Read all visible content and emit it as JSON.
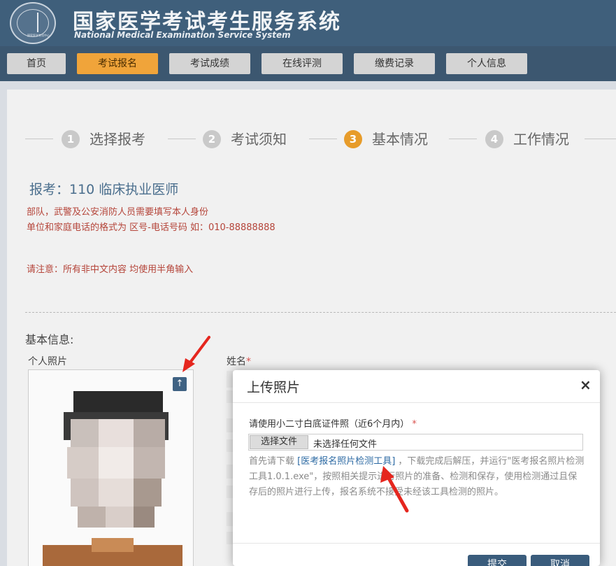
{
  "header": {
    "title": "国家医学考试考生服务系统",
    "subtitle": "National Medical Examination Service System",
    "logo_text": "国家医学考试中心"
  },
  "nav": {
    "items": [
      {
        "label": "首页"
      },
      {
        "label": "考试报名"
      },
      {
        "label": "考试成绩"
      },
      {
        "label": "在线评测"
      },
      {
        "label": "缴费记录"
      },
      {
        "label": "个人信息"
      }
    ],
    "active_index": 1
  },
  "steps": [
    {
      "num": "1",
      "label": "选择报考"
    },
    {
      "num": "2",
      "label": "考试须知"
    },
    {
      "num": "3",
      "label": "基本情况"
    },
    {
      "num": "4",
      "label": "工作情况"
    }
  ],
  "exam": {
    "title": "报考：110 临床执业医师",
    "notes": [
      "部队，武警及公安消防人员需要填写本人身份",
      "单位和家庭电话的格式为 区号-电话号码 如：010-88888888"
    ],
    "attention": "请注意：所有非中文内容 均使用半角输入"
  },
  "form": {
    "section_title": "基本信息:",
    "photo_label": "个人照片",
    "name_label": "姓名",
    "required_mark": "*"
  },
  "modal": {
    "title": "上传照片",
    "close_glyph": "×",
    "photo_label": "请使用小二寸白底证件照（近6个月内）",
    "required_mark": "*",
    "file_button": "选择文件",
    "file_status": "未选择任何文件",
    "desc_before": "首先请下载 ",
    "desc_link": "[医考报名照片检测工具]",
    "desc_after": " ，下载完成后解压，并运行\"医考报名照片检测工具1.0.1.exe\"，按照相关提示进行照片的准备、检测和保存，使用检测通过且保存后的照片进行上传，报名系统不接受未经该工具检测的照片。",
    "submit_label": "提交",
    "cancel_label": "取消"
  },
  "colors": {
    "header_bg": "#3f5f7b",
    "nav_active": "#f0a43a",
    "step_active": "#e79c2b",
    "note_red": "#b5453a",
    "link_blue": "#2d6aa3",
    "arrow_red": "#e5261e"
  },
  "icons": {
    "upload": "upload-icon",
    "close": "close-icon"
  }
}
